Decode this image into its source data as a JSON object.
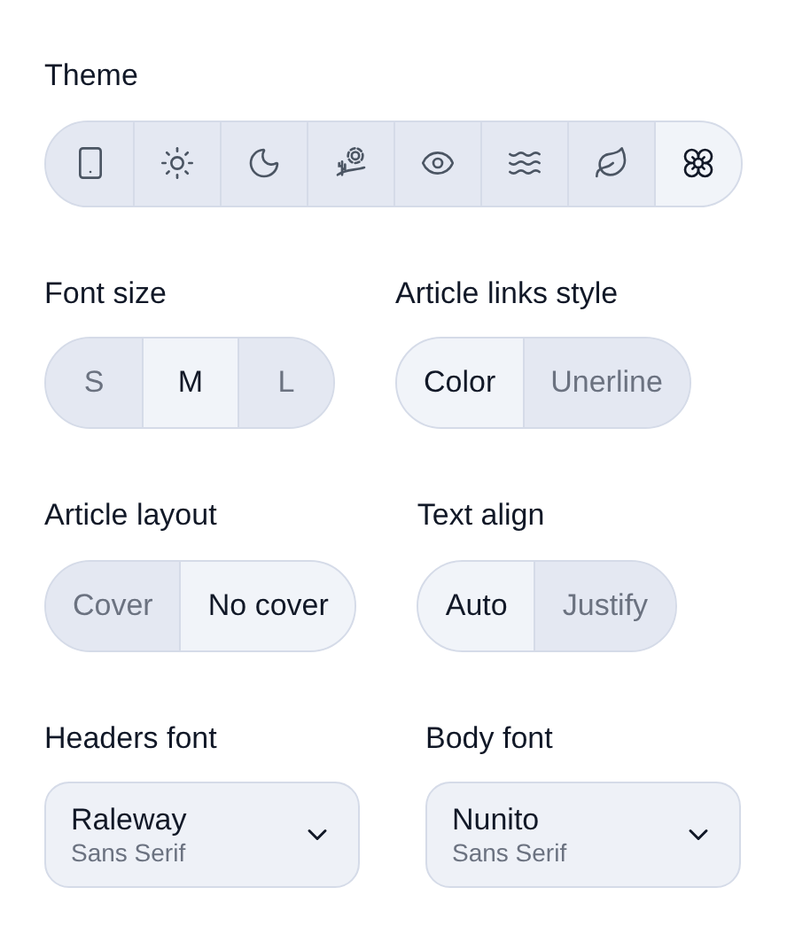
{
  "theme": {
    "label": "Theme",
    "options": [
      {
        "kind": "phone",
        "selected": false
      },
      {
        "kind": "sun",
        "selected": false
      },
      {
        "kind": "moon",
        "selected": false
      },
      {
        "kind": "desert",
        "selected": false
      },
      {
        "kind": "eye",
        "selected": false
      },
      {
        "kind": "waves",
        "selected": false
      },
      {
        "kind": "leaf",
        "selected": false
      },
      {
        "kind": "lotus",
        "selected": true
      }
    ]
  },
  "rows": [
    [
      {
        "label": "Font size",
        "options": [
          {
            "label": "S",
            "selected": false
          },
          {
            "label": "M",
            "selected": true
          },
          {
            "label": "L",
            "selected": false
          }
        ]
      },
      {
        "label": "Article links style",
        "options": [
          {
            "label": "Color",
            "selected": true
          },
          {
            "label": "Unerline",
            "selected": false
          }
        ]
      }
    ],
    [
      {
        "label": "Article layout",
        "options": [
          {
            "label": "Cover",
            "selected": false
          },
          {
            "label": "No cover",
            "selected": true
          }
        ]
      },
      {
        "label": "Text align",
        "options": [
          {
            "label": "Auto",
            "selected": true
          },
          {
            "label": "Justify",
            "selected": false
          }
        ]
      }
    ]
  ],
  "fonts": [
    {
      "label": "Headers font",
      "value": "Raleway",
      "category": "Sans Serif"
    },
    {
      "label": "Body font",
      "value": "Nunito",
      "category": "Sans Serif"
    }
  ]
}
